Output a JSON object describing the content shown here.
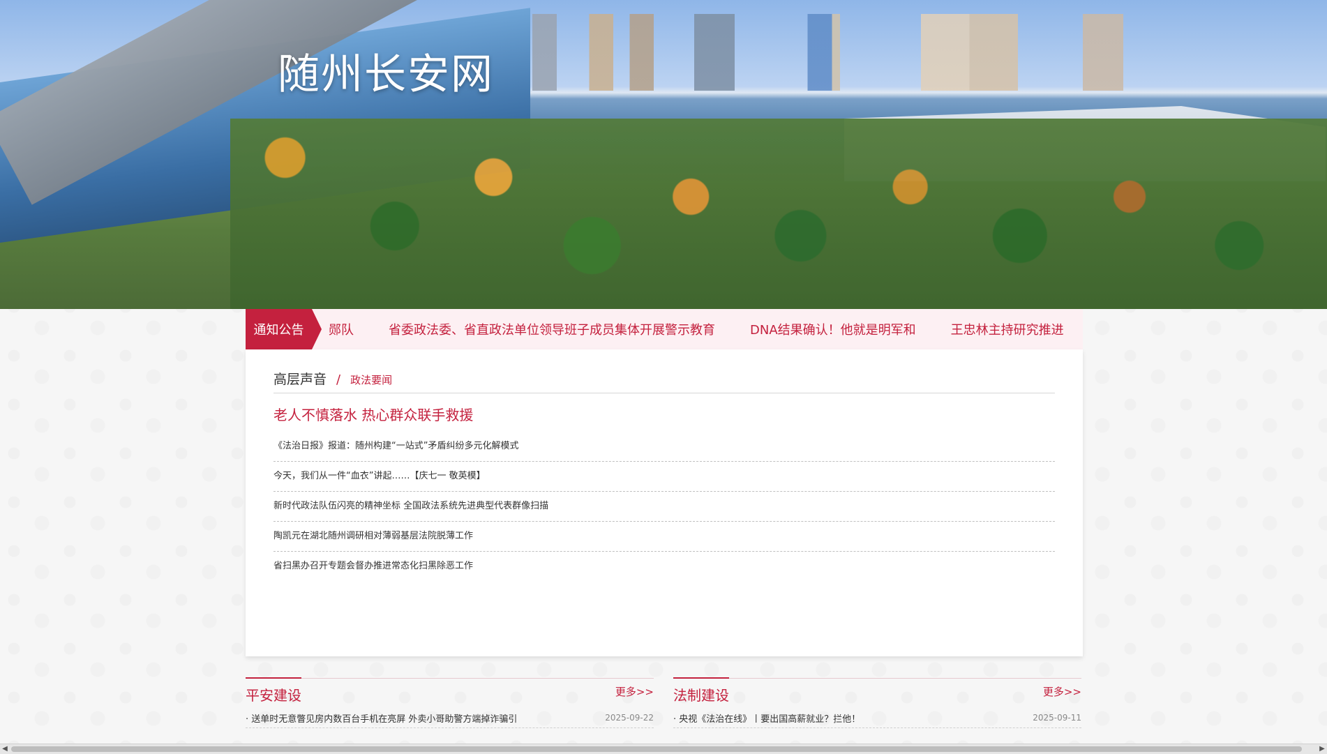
{
  "banner": {
    "site_title": "随州长安网"
  },
  "notice": {
    "label": "通知公告",
    "items": [
      "郧队",
      "省委政法委、省直政法单位领导班子成员集体开展警示教育",
      "DNA结果确认！他就是明军和",
      "王忠林主持研究推进"
    ]
  },
  "main": {
    "tabs": {
      "active": "高层声音",
      "separator": "/",
      "other": "政法要闻"
    },
    "headline": "老人不慎落水 热心群众联手救援",
    "items": [
      "《法治日报》报道：随州构建“一站式”矛盾纠纷多元化解模式",
      "今天，我们从一件“血衣”讲起……【庆七一 敬英模】",
      "新时代政法队伍闪亮的精神坐标 全国政法系统先进典型代表群像扫描",
      "陶凯元在湖北随州调研相对薄弱基层法院脱薄工作",
      "省扫黑办召开专题会督办推进常态化扫黑除恶工作"
    ]
  },
  "sections": {
    "left": {
      "title": "平安建设",
      "more": "更多>>",
      "item_title": "· 送单时无意瞥见房内数百台手机在亮屏 外卖小哥助警方端掉诈骗引",
      "item_date": "2025-09-22"
    },
    "right": {
      "title": "法制建设",
      "more": "更多>>",
      "item_title": "· 央视《法治在线》丨要出国高薪就业？拦他！",
      "item_date": "2025-09-11"
    }
  },
  "scrollbar": {
    "left_arrow": "◀",
    "right_arrow": "▶"
  },
  "colors": {
    "brand_red": "#c4213e",
    "notice_bg": "#fdf0f3"
  }
}
